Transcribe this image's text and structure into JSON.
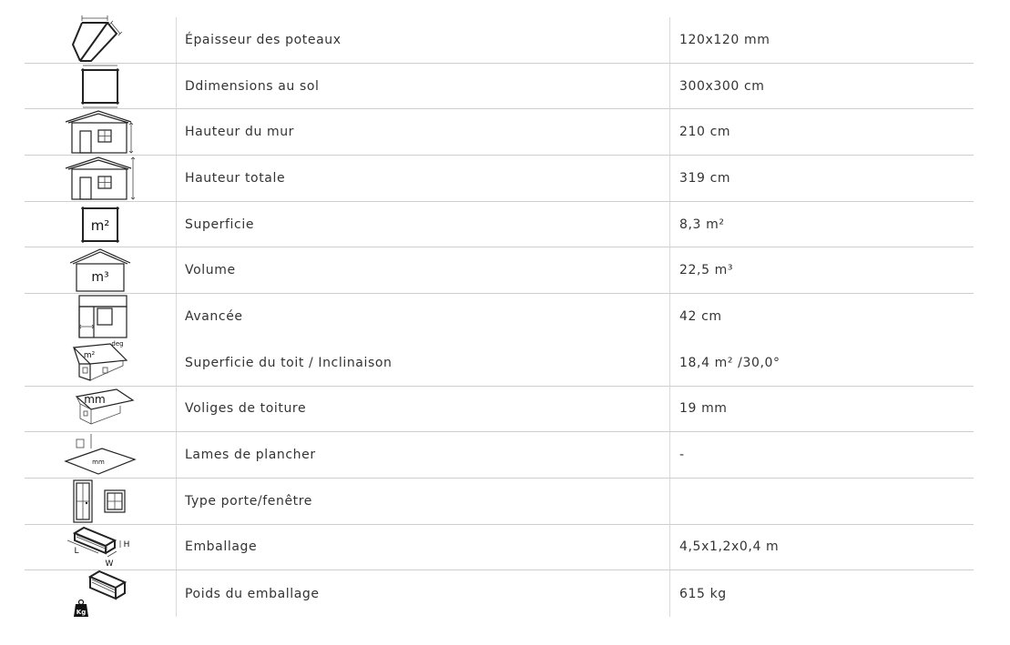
{
  "rows": [
    {
      "icon": "post-thickness-icon",
      "label": "Épaisseur des poteaux",
      "value": "120x120 mm"
    },
    {
      "icon": "floor-dimensions-icon",
      "label": "Ddimensions au sol",
      "value": "300x300 cm"
    },
    {
      "icon": "wall-height-icon",
      "label": "Hauteur du mur",
      "value": "210 cm"
    },
    {
      "icon": "total-height-icon",
      "label": "Hauteur totale",
      "value": "319 cm"
    },
    {
      "icon": "area-icon",
      "label": "Superficie",
      "value": "8,3 m²",
      "icon_text": "m²"
    },
    {
      "icon": "volume-icon",
      "label": "Volume",
      "value": "22,5 m³",
      "icon_text": "m³"
    },
    {
      "icon": "overhang-icon",
      "label": "Avancée",
      "value": "42 cm"
    },
    {
      "icon": "roof-area-slope-icon",
      "label": "Superficie du toit / Inclinaison",
      "value": "18,4 m² /30,0°",
      "icon_text": "m²",
      "icon_text2": "deg"
    },
    {
      "icon": "roof-boards-icon",
      "label": "Voliges de toiture",
      "value": "19 mm",
      "icon_text": "mm"
    },
    {
      "icon": "floor-boards-icon",
      "label": "Lames de plancher",
      "value": "-",
      "icon_text": "mm"
    },
    {
      "icon": "door-window-type-icon",
      "label": "Type porte/fenêtre",
      "value": ""
    },
    {
      "icon": "package-dimensions-icon",
      "label": "Emballage",
      "value": "4,5x1,2x0,4 m",
      "icon_text": "L",
      "icon_text2": "W",
      "icon_text3": "H"
    },
    {
      "icon": "package-weight-icon",
      "label": "Poids du emballage",
      "value": "615 kg",
      "icon_text": "Kg"
    }
  ]
}
